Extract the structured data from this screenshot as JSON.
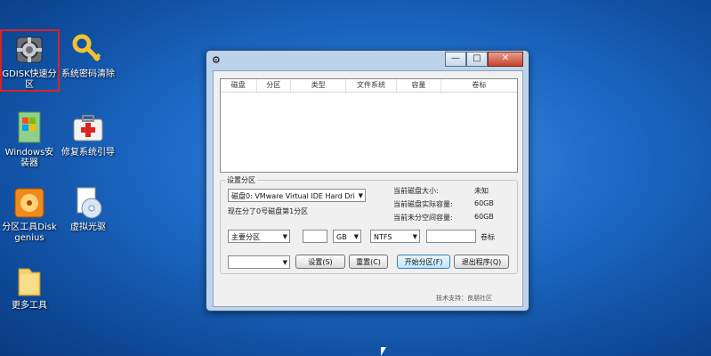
{
  "desktop": {
    "icons": [
      {
        "label": "GDISK快速分区"
      },
      {
        "label": "系统密码清除"
      },
      {
        "label": "Windows安装器"
      },
      {
        "label": "修复系统引导"
      },
      {
        "label": "分区工具Diskgenius"
      },
      {
        "label": "虚拟光驱"
      },
      {
        "label": "更多工具"
      }
    ]
  },
  "window": {
    "controls": {
      "minimize": "—",
      "maximize": "□",
      "close": "✕"
    },
    "list_headers": [
      "磁盘",
      "分区",
      "类型",
      "文件系统",
      "容量",
      "卷标"
    ],
    "group_title": "设置分区",
    "disk_select": "磁盘0: VMware Virtual IDE Hard Dri",
    "current_info": "现在分了0号磁盘第1分区",
    "stats": [
      {
        "label": "当前磁盘大小:",
        "value": "未知"
      },
      {
        "label": "当前磁盘实际容量:",
        "value": "60GB"
      },
      {
        "label": "当前未分空间容量:",
        "value": "60GB"
      }
    ],
    "partition_type": "主要分区",
    "size_unit": "GB",
    "filesystem": "NTFS",
    "volume_label": "卷标",
    "buttons": {
      "set": "设置(S)",
      "reset": "重置(C)",
      "start": "开始分区(F)",
      "exit": "退出程序(Q)"
    },
    "footer": "技术支持：良朋社区"
  }
}
